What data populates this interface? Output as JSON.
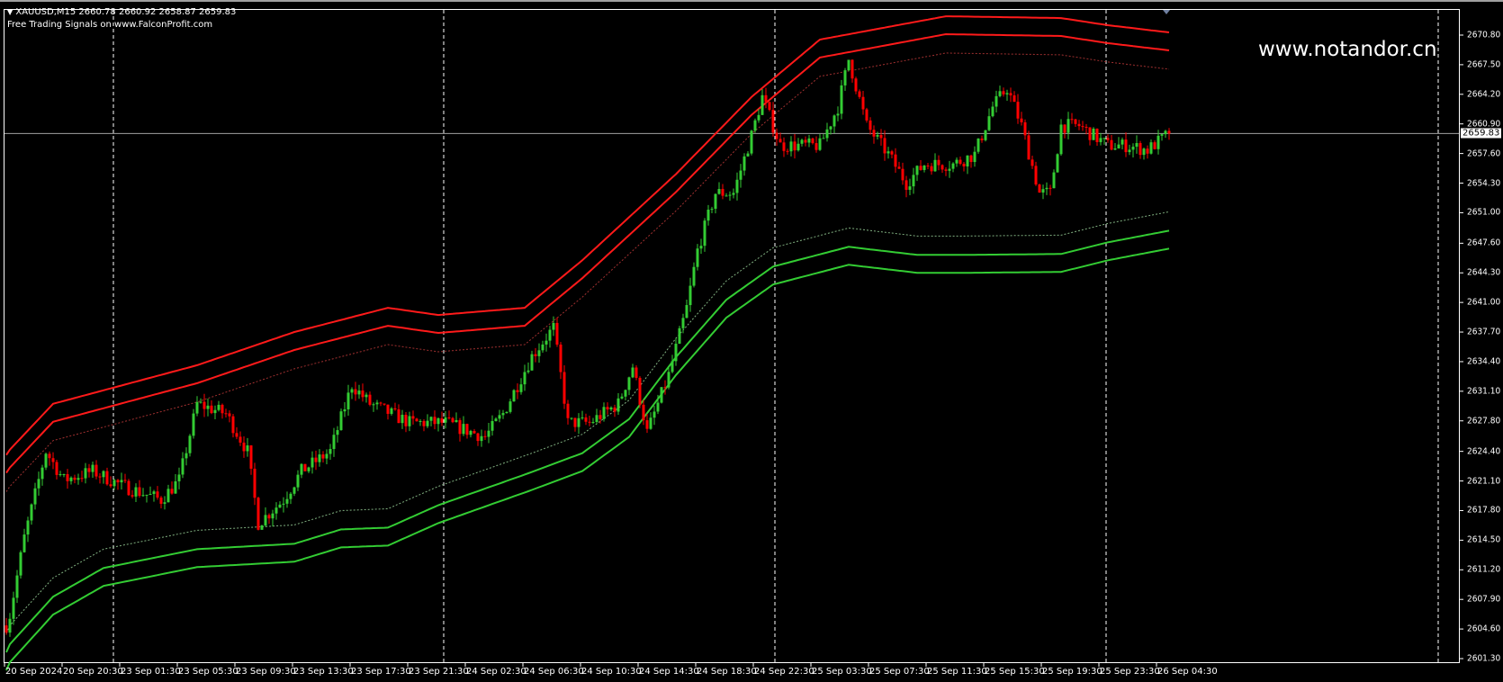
{
  "header": {
    "symbol_line": "XAUUSD,M15  2660.78 2660.92 2658.87 2659.83",
    "indicator_line": "Free Trading Signals on www.FalconProfit.com"
  },
  "watermark": "www.notandor.cn",
  "colors": {
    "background": "#000000",
    "bull": "#33cc33",
    "bear": "#ff0000",
    "upper_band": "#ff1a1a",
    "lower_band": "#33cc33",
    "current_price_line": "#a0a0a0"
  },
  "chart_data": {
    "type": "candlestick",
    "title": "XAUUSD,M15",
    "ylim": [
      2600.3,
      2673.6
    ],
    "bar_count": 324,
    "current_price": "2659.83",
    "y_ticks": [
      "2670.80",
      "2667.50",
      "2664.20",
      "2660.90",
      "2657.60",
      "2654.30",
      "2651.00",
      "2647.60",
      "2644.30",
      "2641.00",
      "2637.70",
      "2634.40",
      "2631.10",
      "2627.80",
      "2624.40",
      "2621.10",
      "2617.80",
      "2614.50",
      "2611.20",
      "2607.90",
      "2604.60",
      "2601.30"
    ],
    "x_ticks": [
      "20 Sep 2024",
      "20 Sep 20:30",
      "23 Sep 01:30",
      "23 Sep 05:30",
      "23 Sep 09:30",
      "23 Sep 13:30",
      "23 Sep 17:30",
      "23 Sep 21:30",
      "24 Sep 02:30",
      "24 Sep 06:30",
      "24 Sep 10:30",
      "24 Sep 14:30",
      "24 Sep 18:30",
      "24 Sep 22:30",
      "25 Sep 03:30",
      "25 Sep 07:30",
      "25 Sep 11:30",
      "25 Sep 15:30",
      "25 Sep 19:30",
      "25 Sep 23:30",
      "26 Sep 04:30"
    ],
    "close_path": [
      [
        0,
        2605.0
      ],
      [
        1,
        2606.2
      ],
      [
        5,
        2614.8
      ],
      [
        11,
        2624.4
      ],
      [
        16,
        2621.2
      ],
      [
        24,
        2622.2
      ],
      [
        32,
        2620.6
      ],
      [
        43,
        2619.0
      ],
      [
        48,
        2621.2
      ],
      [
        53,
        2629.7
      ],
      [
        61,
        2628.6
      ],
      [
        67,
        2624.4
      ],
      [
        70,
        2616.4
      ],
      [
        77,
        2619.0
      ],
      [
        82,
        2622.2
      ],
      [
        90,
        2624.4
      ],
      [
        96,
        2631.8
      ],
      [
        101,
        2629.7
      ],
      [
        112,
        2627.6
      ],
      [
        122,
        2627.6
      ],
      [
        133,
        2626.0
      ],
      [
        138,
        2628.6
      ],
      [
        146,
        2635.0
      ],
      [
        152,
        2638.2
      ],
      [
        156,
        2627.6
      ],
      [
        162,
        2627.6
      ],
      [
        170,
        2629.7
      ],
      [
        174,
        2633.9
      ],
      [
        178,
        2626.5
      ],
      [
        184,
        2632.9
      ],
      [
        189,
        2640.4
      ],
      [
        192,
        2646.8
      ],
      [
        197,
        2653.2
      ],
      [
        202,
        2653.2
      ],
      [
        207,
        2659.6
      ],
      [
        210,
        2663.9
      ],
      [
        215,
        2658.5
      ],
      [
        226,
        2658.5
      ],
      [
        231,
        2662.8
      ],
      [
        234,
        2668.1
      ],
      [
        239,
        2660.7
      ],
      [
        245,
        2657.5
      ],
      [
        250,
        2654.3
      ],
      [
        255,
        2656.4
      ],
      [
        263,
        2656.4
      ],
      [
        269,
        2657.5
      ],
      [
        274,
        2662.8
      ],
      [
        278,
        2664.9
      ],
      [
        282,
        2660.7
      ],
      [
        287,
        2653.2
      ],
      [
        290,
        2653.2
      ],
      [
        293,
        2660.7
      ],
      [
        298,
        2660.7
      ],
      [
        306,
        2658.5
      ],
      [
        311,
        2658.5
      ],
      [
        317,
        2658.0
      ],
      [
        323,
        2659.83
      ]
    ],
    "bands": {
      "upper_outer": [
        [
          0,
          2624.0
        ],
        [
          1,
          2624.6
        ],
        [
          13,
          2629.7
        ],
        [
          53,
          2634.0
        ],
        [
          80,
          2637.7
        ],
        [
          106,
          2640.4
        ],
        [
          120,
          2639.6
        ],
        [
          144,
          2640.4
        ],
        [
          160,
          2645.7
        ],
        [
          186,
          2655.3
        ],
        [
          207,
          2663.9
        ],
        [
          226,
          2670.3
        ],
        [
          261,
          2672.9
        ],
        [
          293,
          2672.7
        ],
        [
          306,
          2671.9
        ],
        [
          323,
          2671.1
        ]
      ],
      "lower_outer": [
        [
          0,
          2600.0
        ],
        [
          1,
          2600.9
        ],
        [
          13,
          2606.2
        ],
        [
          27,
          2609.4
        ],
        [
          53,
          2611.5
        ],
        [
          80,
          2612.1
        ],
        [
          93,
          2613.7
        ],
        [
          106,
          2613.9
        ],
        [
          120,
          2616.4
        ],
        [
          146,
          2620.1
        ],
        [
          160,
          2622.2
        ],
        [
          173,
          2626.0
        ],
        [
          186,
          2632.9
        ],
        [
          200,
          2639.3
        ],
        [
          213,
          2643.0
        ],
        [
          234,
          2645.2
        ],
        [
          253,
          2644.3
        ],
        [
          266,
          2644.3
        ],
        [
          293,
          2644.4
        ],
        [
          306,
          2645.7
        ],
        [
          323,
          2647.0
        ]
      ],
      "inner_offset": 2.0,
      "dotted_offset": 4.1
    }
  }
}
